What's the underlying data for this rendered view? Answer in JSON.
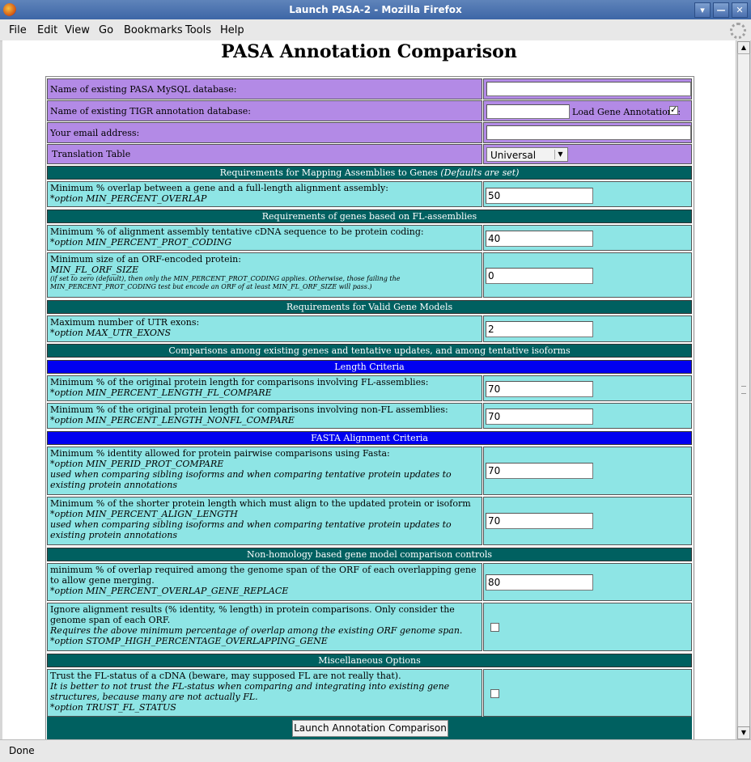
{
  "window": {
    "title": "Launch PASA-2 - Mozilla Firefox",
    "buttons": [
      "▾",
      "—",
      "✕"
    ]
  },
  "menu": [
    "File",
    "Edit",
    "View",
    "Go",
    "Bookmarks",
    "Tools",
    "Help"
  ],
  "status": "Done",
  "page": {
    "title": "PASA Annotation Comparison",
    "db_label": "Name of existing PASA MySQL database:",
    "db_value": "",
    "tigr_label": "Name of existing TIGR annotation database:",
    "tigr_value": "",
    "load_gene_label": "Load Gene Annotations:",
    "load_gene_checked": true,
    "email_label": "Your email address:",
    "email_value": "",
    "translation_label": "Translation Table",
    "translation_value": "Universal",
    "sec1": "Requirements for Mapping Assemblies to Genes",
    "sec1_note": "(Defaults are set)",
    "overlap_label": "Minimum % overlap between a gene and a full-length alignment assembly:",
    "overlap_opt": "*option MIN_PERCENT_OVERLAP",
    "overlap_value": "50",
    "sec2": "Requirements of genes based on FL-assemblies",
    "prot_coding_label": "Minimum % of alignment assembly tentative cDNA sequence to be protein coding:",
    "prot_coding_opt": "*option MIN_PERCENT_PROT_CODING",
    "prot_coding_value": "40",
    "orf_label": "Minimum size of an ORF-encoded protein:",
    "orf_opt": "MIN_FL_ORF_SIZE",
    "orf_note": "(if set to zero (default), then only the MIN_PERCENT_PROT_CODING applies. Otherwise, those failing the MIN_PERCENT_PROT_CODING test but encode an ORF of at least MIN_FL_ORF_SIZE will pass.)",
    "orf_value": "0",
    "sec3": "Requirements for Valid Gene Models",
    "utr_label": "Maximum number of UTR exons:",
    "utr_opt": "*option MAX_UTR_EXONS",
    "utr_value": "2",
    "sec4": "Comparisons among existing genes and tentative updates, and among tentative isoforms",
    "sec_len": "Length Criteria",
    "len_fl_label": "Minimum % of the original protein length for comparisons involving FL-assemblies:",
    "len_fl_opt": "*option MIN_PERCENT_LENGTH_FL_COMPARE",
    "len_fl_value": "70",
    "len_nonfl_label": "Minimum % of the original protein length for comparisons involving non-FL assemblies:",
    "len_nonfl_opt": "*option MIN_PERCENT_LENGTH_NONFL_COMPARE",
    "len_nonfl_value": "70",
    "sec_fasta": "FASTA Alignment Criteria",
    "perid_label": "Minimum % identity allowed for protein pairwise comparisons using Fasta:",
    "perid_opt": "*option MIN_PERID_PROT_COMPARE",
    "perid_note": "used when comparing sibling isoforms and when comparing tentative protein updates to existing protein annotations",
    "perid_value": "70",
    "align_label": "Minimum % of the shorter protein length which must align to the updated protein or isoform",
    "align_opt": "*option MIN_PERCENT_ALIGN_LENGTH",
    "align_note": "used when comparing sibling isoforms and when comparing tentative protein updates to existing protein annotations",
    "align_value": "70",
    "sec5": "Non-homology based gene model comparison controls",
    "replace_label": "minimum % of overlap required among the genome span of the ORF of each overlapping gene to allow gene merging.",
    "replace_opt": "*option MIN_PERCENT_OVERLAP_GENE_REPLACE",
    "replace_value": "80",
    "ignore_label": "Ignore alignment results (% identity, % length) in protein comparisons. Only consider the genome span of each ORF.",
    "ignore_note": "Requires the above minimum percentage of overlap among the existing ORF genome span.",
    "ignore_opt": "*option STOMP_HIGH_PERCENTAGE_OVERLAPPING_GENE",
    "ignore_checked": false,
    "sec6": "Miscellaneous Options",
    "trust_label": "Trust the FL-status of a cDNA (beware, may supposed FL are not really that).",
    "trust_note": "It is better to not trust the FL-status when comparing and integrating into existing gene structures, because many are not actually FL.",
    "trust_opt": "*option TRUST_FL_STATUS",
    "trust_checked": false,
    "submit_label": "Launch Annotation Comparison"
  }
}
